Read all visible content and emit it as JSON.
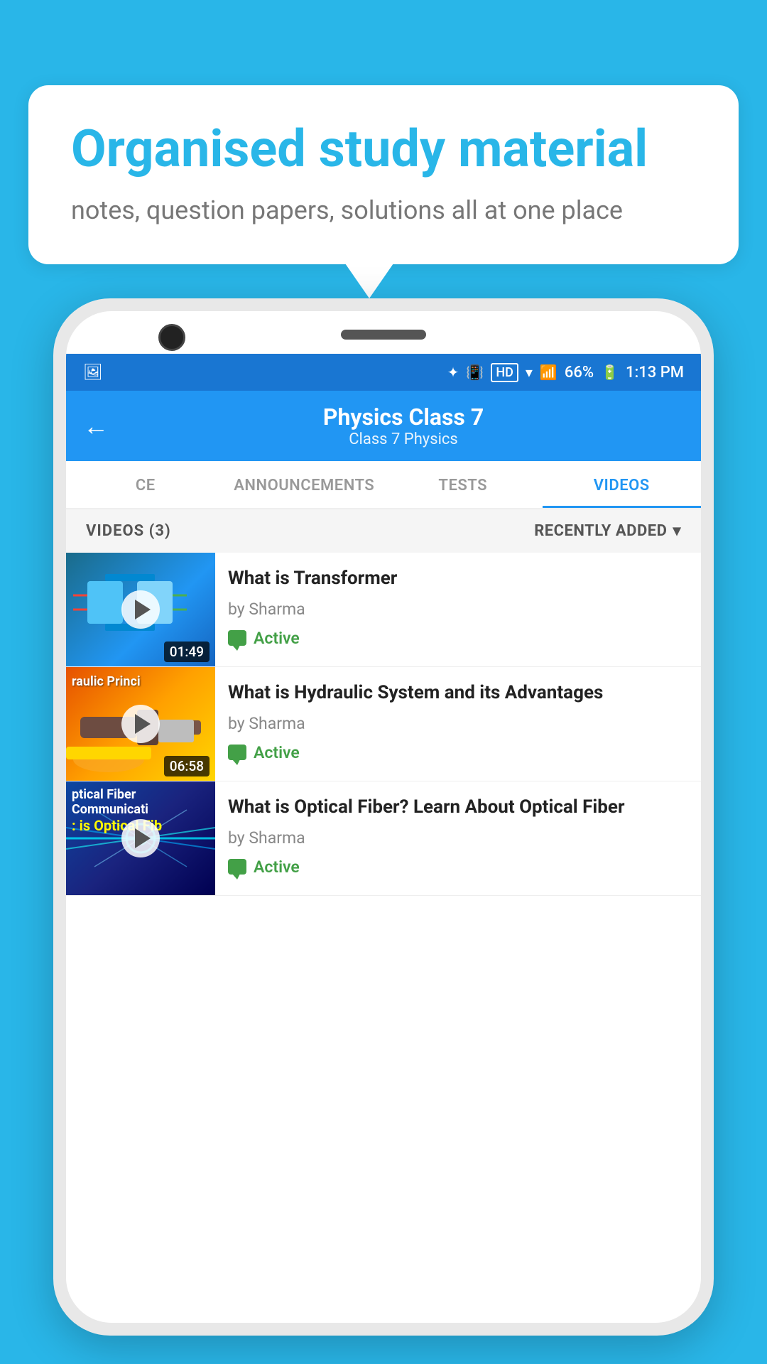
{
  "background_color": "#29b6e8",
  "speech_bubble": {
    "heading": "Organised study material",
    "subtext": "notes, question papers, solutions all at one place"
  },
  "status_bar": {
    "time": "1:13 PM",
    "battery": "66%",
    "signal": "HD"
  },
  "app_bar": {
    "back_label": "←",
    "title": "Physics Class 7",
    "breadcrumb": "Class 7   Physics"
  },
  "tabs": [
    {
      "id": "ce",
      "label": "CE",
      "active": false
    },
    {
      "id": "announcements",
      "label": "ANNOUNCEMENTS",
      "active": false
    },
    {
      "id": "tests",
      "label": "TESTS",
      "active": false
    },
    {
      "id": "videos",
      "label": "VIDEOS",
      "active": true
    }
  ],
  "videos_header": {
    "count_label": "VIDEOS (3)",
    "sort_label": "RECENTLY ADDED"
  },
  "videos": [
    {
      "id": 1,
      "title": "What is  Transformer",
      "author": "by Sharma",
      "status": "Active",
      "duration": "01:49",
      "thumb_type": "transformer"
    },
    {
      "id": 2,
      "title": "What is Hydraulic System and its Advantages",
      "author": "by Sharma",
      "status": "Active",
      "duration": "06:58",
      "thumb_type": "hydraulic"
    },
    {
      "id": 3,
      "title": "What is Optical Fiber? Learn About Optical Fiber",
      "author": "by Sharma",
      "status": "Active",
      "duration": "",
      "thumb_type": "optical"
    }
  ]
}
